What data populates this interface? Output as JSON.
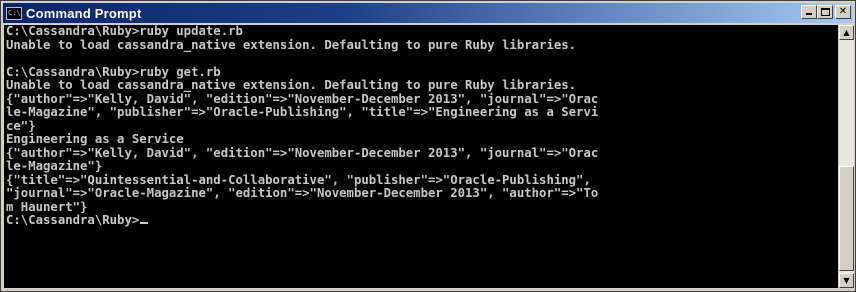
{
  "window": {
    "title": "Command Prompt",
    "icon": "console-icon",
    "icon_text": "C:\\",
    "buttons": {
      "minimize_icon": "minimize-icon",
      "maximize_icon": "maximize-icon",
      "close_icon": "close-icon",
      "close_glyph": "✕"
    }
  },
  "console": {
    "background": "#000000",
    "foreground": "#c0c0c0",
    "lines": [
      "C:\\Cassandra\\Ruby>ruby update.rb",
      "Unable to load cassandra_native extension. Defaulting to pure Ruby libraries.",
      "",
      "C:\\Cassandra\\Ruby>ruby get.rb",
      "Unable to load cassandra_native extension. Defaulting to pure Ruby libraries.",
      "{\"author\"=>\"Kelly, David\", \"edition\"=>\"November-December 2013\", \"journal\"=>\"Orac",
      "le-Magazine\", \"publisher\"=>\"Oracle-Publishing\", \"title\"=>\"Engineering as a Servi",
      "ce\"}",
      "Engineering as a Service",
      "{\"author\"=>\"Kelly, David\", \"edition\"=>\"November-December 2013\", \"journal\"=>\"Orac",
      "le-Magazine\"}",
      "{\"title\"=>\"Quintessential-and-Collaborative\", \"publisher\"=>\"Oracle-Publishing\",",
      "\"journal\"=>\"Oracle-Magazine\", \"edition\"=>\"November-December 2013\", \"author\"=>\"To",
      "m Haunert\"}",
      "C:\\Cassandra\\Ruby>"
    ]
  },
  "scrollbar": {
    "up_arrow": "▲",
    "down_arrow": "▼"
  }
}
